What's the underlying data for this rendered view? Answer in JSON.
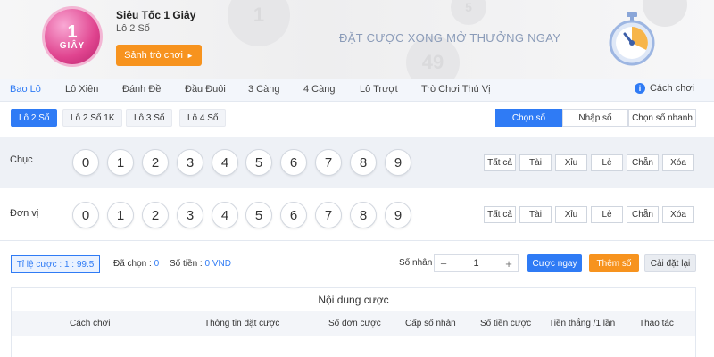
{
  "header": {
    "logo_line1": "1",
    "logo_line2": "GIÂY",
    "title": "Siêu Tốc 1 Giây",
    "subtitle": "Lô 2 Số",
    "lobby_button": "Sảnh trò chơi",
    "lobby_arrow": "►",
    "slogan": "ĐẶT CƯỢC XONG MỞ THƯỞNG NGAY",
    "bg_balls": [
      "49",
      "5",
      "1"
    ]
  },
  "tabs": [
    {
      "label": "Bao Lô",
      "active": true
    },
    {
      "label": "Lô Xiên"
    },
    {
      "label": "Đánh Đề"
    },
    {
      "label": "Đầu Đuôi"
    },
    {
      "label": "3 Càng"
    },
    {
      "label": "4 Càng"
    },
    {
      "label": "Lô Trượt"
    },
    {
      "label": "Trò Chơi Thú Vị"
    }
  ],
  "rules_link": "Cách chơi",
  "subtypes": [
    {
      "label": "Lô 2 Số",
      "active": true
    },
    {
      "label": "Lô 2 Số 1K"
    },
    {
      "label": "Lô 3 Số"
    },
    {
      "label": "Lô 4 Số"
    }
  ],
  "modes": [
    {
      "label": "Chọn số",
      "active": true
    },
    {
      "label": "Nhập số"
    },
    {
      "label": "Chọn số nhanh"
    }
  ],
  "rows": [
    {
      "label": "Chục"
    },
    {
      "label": "Đơn vị"
    }
  ],
  "digits": [
    "0",
    "1",
    "2",
    "3",
    "4",
    "5",
    "6",
    "7",
    "8",
    "9"
  ],
  "quick_buttons": [
    "Tất cả",
    "Tài",
    "Xỉu",
    "Lẻ",
    "Chẵn",
    "Xóa"
  ],
  "bet": {
    "odds": "Tỉ lệ cược : 1 : 99.5",
    "selected_label": "Đã chọn :",
    "selected_value": "0",
    "amount_label": "Số tiền :",
    "amount_value": "0 VND",
    "multiplier_label": "Số nhân :",
    "multiplier_value": "1",
    "minus": "−",
    "plus": "+",
    "bet_now": "Cược ngay",
    "add_number": "Thêm số",
    "reset": "Cài đặt lại"
  },
  "table": {
    "title": "Nội dung cược",
    "columns": [
      "Cách chơi",
      "Thông tin đặt cược",
      "Số đơn cược",
      "Cấp số nhân",
      "Số tiền cược",
      "Tiền thắng /1 lần",
      "Thao tác"
    ]
  },
  "colors": {
    "accent": "#2f7bf5",
    "orange": "#f7931e",
    "logo_pink": "#e0448f"
  }
}
